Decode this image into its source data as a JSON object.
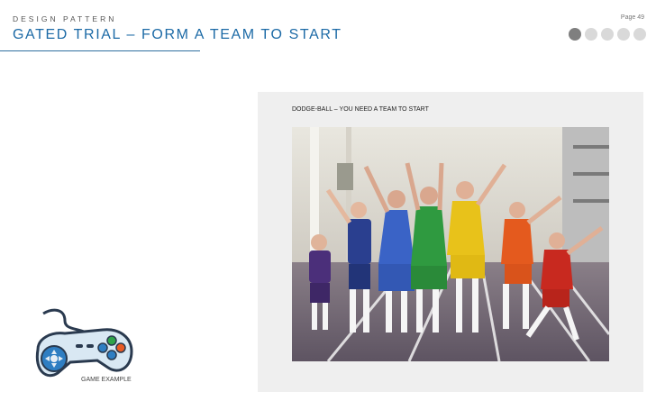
{
  "header": {
    "kicker": "DESIGN PATTERN",
    "title": "GATED TRIAL – FORM A TEAM TO START",
    "page_label": "Page 49"
  },
  "pagination": {
    "count": 5,
    "active_index": 0
  },
  "figure": {
    "caption": "DODGE-BALL – YOU NEED A TEAM TO START",
    "photo_icon": "team-photo"
  },
  "game_example": {
    "label": "GAME EXAMPLE",
    "icon": "gamepad-icon"
  },
  "colors": {
    "accent": "#1c6aa6",
    "panel": "#efefef",
    "dot_active": "#7f7f7f",
    "dot_inactive": "#d9d9d9",
    "team": [
      "#4b2f7a",
      "#2a3f8f",
      "#3a63c6",
      "#2f9a40",
      "#e8c21a",
      "#e45a1e",
      "#c8291f"
    ]
  }
}
